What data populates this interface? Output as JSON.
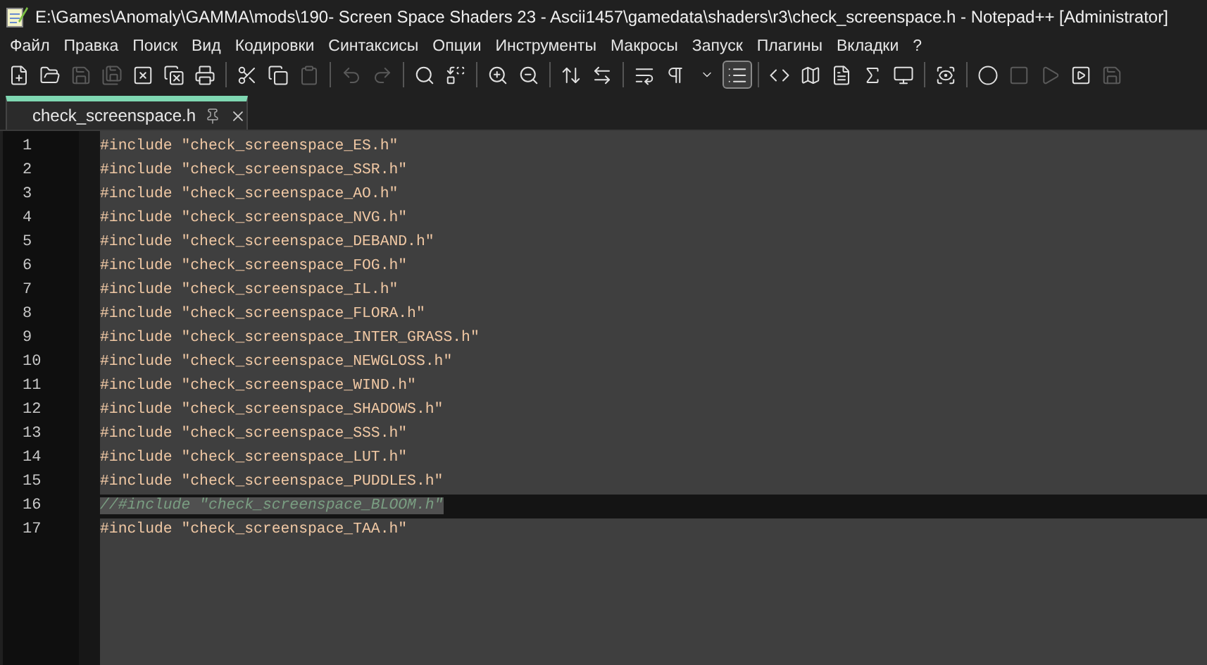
{
  "window": {
    "title": "E:\\Games\\Anomaly\\GAMMA\\mods\\190- Screen Space Shaders 23 - Ascii1457\\gamedata\\shaders\\r3\\check_screenspace.h - Notepad++ [Administrator]"
  },
  "menu": [
    "Файл",
    "Правка",
    "Поиск",
    "Вид",
    "Кодировки",
    "Синтаксисы",
    "Опции",
    "Инструменты",
    "Макросы",
    "Запуск",
    "Плагины",
    "Вкладки",
    "?"
  ],
  "toolbar": [
    {
      "disabled": false,
      "active": false
    },
    {
      "disabled": false,
      "active": false
    },
    {
      "disabled": true,
      "active": false
    },
    {
      "disabled": true,
      "active": false
    },
    {
      "disabled": false,
      "active": false
    },
    {
      "disabled": false,
      "active": false
    },
    {
      "disabled": false,
      "active": false
    },
    {
      "disabled": false,
      "active": false
    },
    {
      "disabled": false,
      "active": false
    },
    {
      "disabled": true,
      "active": false
    },
    {
      "disabled": true,
      "active": false
    },
    {
      "disabled": true,
      "active": false
    },
    {
      "disabled": false,
      "active": false
    },
    {
      "disabled": false,
      "active": false
    },
    {
      "disabled": false,
      "active": false
    },
    {
      "disabled": false,
      "active": false
    },
    {
      "disabled": false,
      "active": false
    },
    {
      "disabled": false,
      "active": false
    },
    {
      "disabled": false,
      "active": false
    },
    {
      "disabled": false,
      "active": false
    },
    {
      "disabled": false,
      "active": false
    },
    {
      "disabled": false,
      "active": true
    },
    {
      "disabled": false,
      "active": false
    },
    {
      "disabled": false,
      "active": false
    },
    {
      "disabled": false,
      "active": false
    },
    {
      "disabled": false,
      "active": false
    },
    {
      "disabled": false,
      "active": false
    },
    {
      "disabled": false,
      "active": false
    },
    {
      "disabled": false,
      "active": false
    },
    {
      "disabled": true,
      "active": false
    },
    {
      "disabled": true,
      "active": false
    },
    {
      "disabled": false,
      "active": false
    },
    {
      "disabled": true,
      "active": false
    }
  ],
  "tabs": [
    {
      "label": "check_screenspace.h",
      "selected": true
    }
  ],
  "lines": [
    {
      "number": "1",
      "text": "#include \"check_screenspace_ES.h\"",
      "kind": "include",
      "selected": false
    },
    {
      "number": "2",
      "text": "#include \"check_screenspace_SSR.h\"",
      "kind": "include",
      "selected": false
    },
    {
      "number": "3",
      "text": "#include \"check_screenspace_AO.h\"",
      "kind": "include",
      "selected": false
    },
    {
      "number": "4",
      "text": "#include \"check_screenspace_NVG.h\"",
      "kind": "include",
      "selected": false
    },
    {
      "number": "5",
      "text": "#include \"check_screenspace_DEBAND.h\"",
      "kind": "include",
      "selected": false
    },
    {
      "number": "6",
      "text": "#include \"check_screenspace_FOG.h\"",
      "kind": "include",
      "selected": false
    },
    {
      "number": "7",
      "text": "#include \"check_screenspace_IL.h\"",
      "kind": "include",
      "selected": false
    },
    {
      "number": "8",
      "text": "#include \"check_screenspace_FLORA.h\"",
      "kind": "include",
      "selected": false
    },
    {
      "number": "9",
      "text": "#include \"check_screenspace_INTER_GRASS.h\"",
      "kind": "include",
      "selected": false
    },
    {
      "number": "10",
      "text": "#include \"check_screenspace_NEWGLOSS.h\"",
      "kind": "include",
      "selected": false
    },
    {
      "number": "11",
      "text": "#include \"check_screenspace_WIND.h\"",
      "kind": "include",
      "selected": false
    },
    {
      "number": "12",
      "text": "#include \"check_screenspace_SHADOWS.h\"",
      "kind": "include",
      "selected": false
    },
    {
      "number": "13",
      "text": "#include \"check_screenspace_SSS.h\"",
      "kind": "include",
      "selected": false
    },
    {
      "number": "14",
      "text": "#include \"check_screenspace_LUT.h\"",
      "kind": "include",
      "selected": false
    },
    {
      "number": "15",
      "text": "#include \"check_screenspace_PUDDLES.h\"",
      "kind": "include",
      "selected": false
    },
    {
      "number": "16",
      "text": "//#include \"check_screenspace_BLOOM.h\"",
      "kind": "comment",
      "selected": true
    },
    {
      "number": "17",
      "text": "#include \"check_screenspace_TAA.h\"",
      "kind": "include",
      "selected": false
    }
  ]
}
